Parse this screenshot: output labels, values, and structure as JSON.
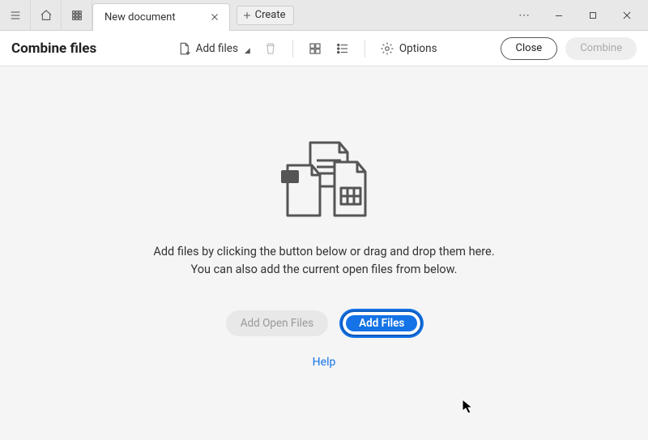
{
  "titlebar": {
    "tab_label": "New document",
    "create_label": "Create"
  },
  "toolbar": {
    "page_title": "Combine files",
    "add_files_label": "Add files",
    "options_label": "Options",
    "close_label": "Close",
    "combine_label": "Combine"
  },
  "main": {
    "instruction_line1": "Add files by clicking the button below or drag and drop them here.",
    "instruction_line2": "You can also add the current open files from below.",
    "add_open_files_label": "Add Open Files",
    "add_files_label": "Add Files",
    "help_label": "Help"
  }
}
